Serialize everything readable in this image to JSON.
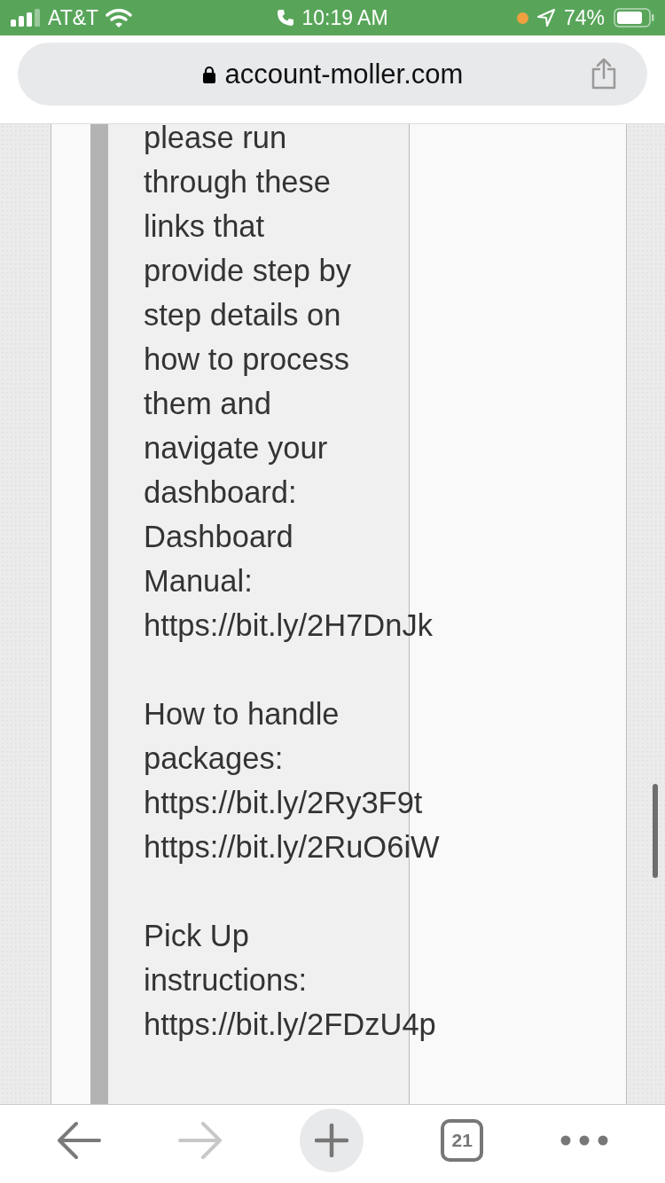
{
  "status_bar": {
    "carrier": "AT&T",
    "time": "10:19 AM",
    "battery": "74%"
  },
  "address_bar": {
    "url": "account-moller.com"
  },
  "message": {
    "intro": "please run through these links that provide step by step details on how to process them and navigate your dashboard:",
    "sections": [
      {
        "title": "Dashboard Manual:",
        "links": [
          "https://bit.ly/2H7DnJk"
        ]
      },
      {
        "title": "How to handle packages:",
        "links": [
          "https://bit.ly/2Ry3F9t",
          "https://bit.ly/2RuO6iW"
        ]
      },
      {
        "title": "Pick Up instructions:",
        "links": [
          "https://bit.ly/2FDzU4p"
        ]
      }
    ]
  },
  "toolbar": {
    "forward_disabled": true,
    "tab_count": "21"
  }
}
